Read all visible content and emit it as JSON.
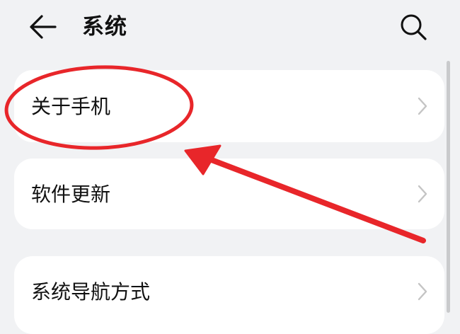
{
  "header": {
    "title": "系统",
    "back_icon": "arrow-left-icon",
    "search_icon": "search-icon"
  },
  "settings_items": [
    {
      "label": "关于手机",
      "icon": "chevron-right-icon"
    },
    {
      "label": "软件更新",
      "icon": "chevron-right-icon"
    },
    {
      "label": "系统导航方式",
      "icon": "chevron-right-icon"
    }
  ],
  "colors": {
    "background": "#f1f2f4",
    "card": "#ffffff",
    "annotation_red": "#e8262a",
    "chevron": "#c4c4c4"
  }
}
